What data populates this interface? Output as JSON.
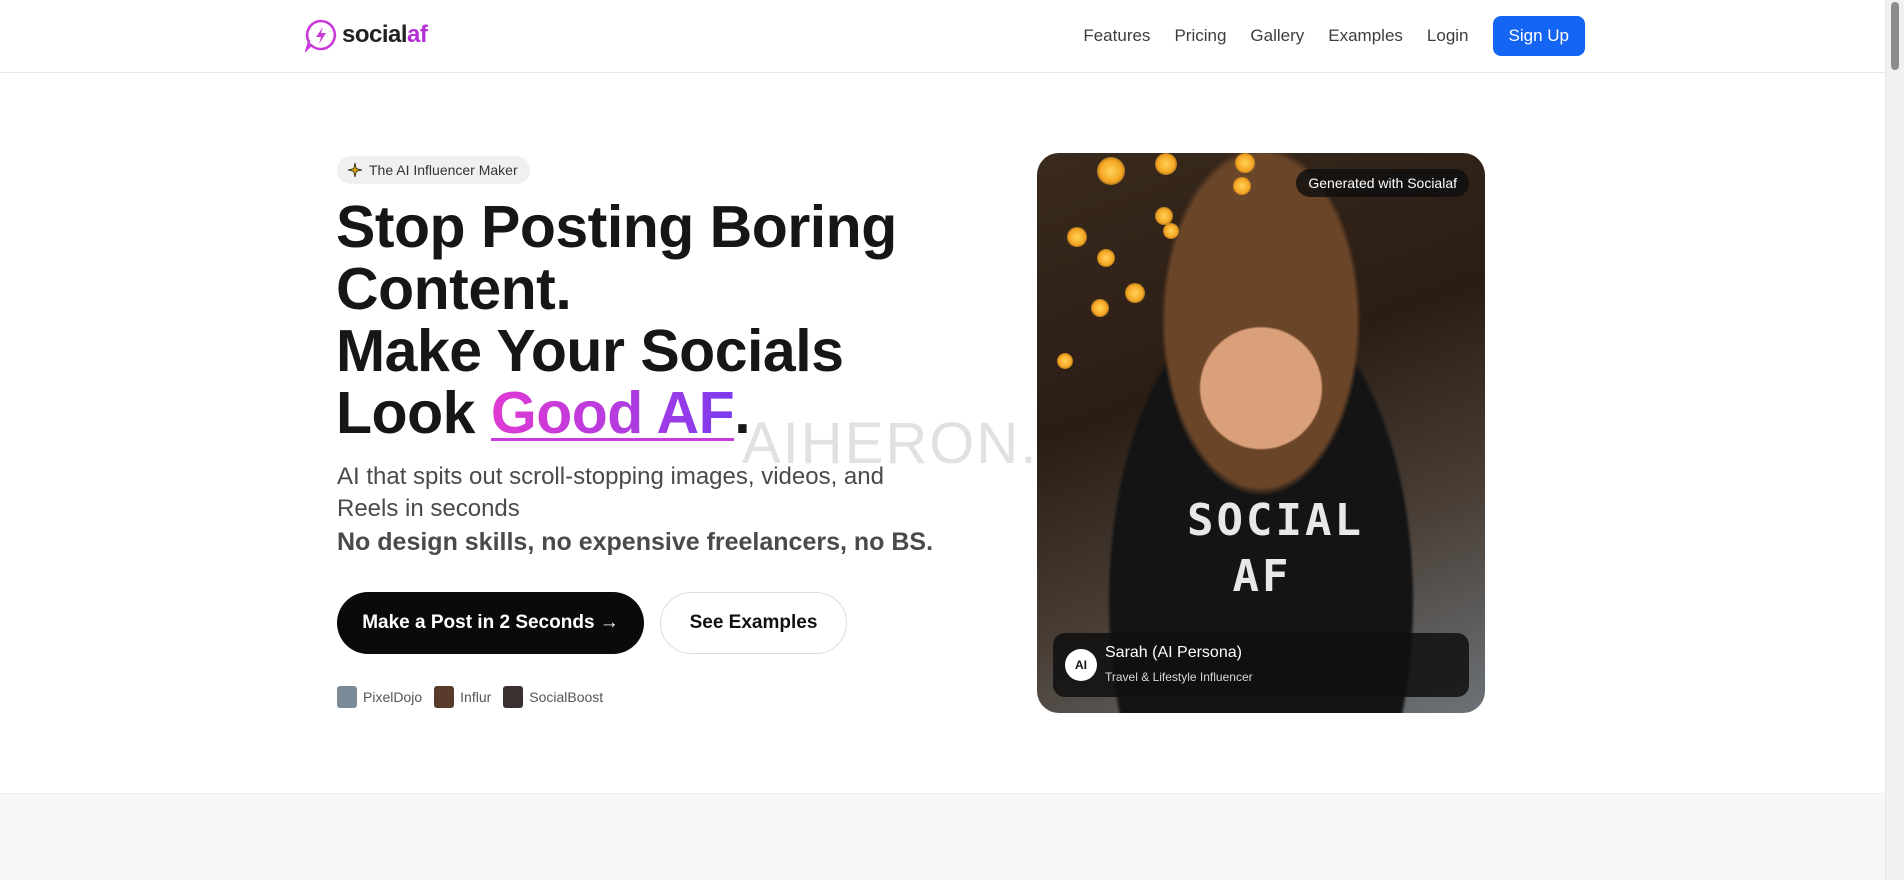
{
  "header": {
    "logo": {
      "name_prefix": "social",
      "name_suffix": "af"
    },
    "nav": [
      "Features",
      "Pricing",
      "Gallery",
      "Examples",
      "Login"
    ],
    "signup_label": "Sign Up"
  },
  "hero": {
    "badge": {
      "icon": "sparkle-icon",
      "label": "The AI Influencer Maker"
    },
    "headline": {
      "line1": "Stop Posting Boring",
      "line2": "Content.",
      "line3": "Make Your Socials",
      "line4_prefix": "Look ",
      "line4_highlight": "Good AF",
      "line4_suffix": "."
    },
    "subtext": "AI that spits out scroll-stopping images, videos, and Reels in seconds",
    "subtext_bold": "No design skills, no expensive freelancers, no BS.",
    "cta_primary": "Make a Post in 2 Seconds →",
    "cta_secondary": "See Examples",
    "partners": [
      {
        "name": "PixelDojo",
        "color": "#7a8a96"
      },
      {
        "name": "Influr",
        "color": "#5a3a2a"
      },
      {
        "name": "SocialBoost",
        "color": "#3a3030"
      }
    ]
  },
  "card": {
    "tag": "Generated with Socialaf",
    "shirt_line1": "SOCIAL",
    "shirt_line2": "AF",
    "persona": {
      "avatar": "AI",
      "name": "Sarah (AI Persona)",
      "role": "Travel & Lifestyle Influencer"
    }
  },
  "watermark": "AIHERON.C",
  "colors": {
    "brand_pink": "#b62fd8",
    "primary_blue": "#1565f5",
    "gradient_start": "#e03ad2",
    "gradient_end": "#7a3bf0"
  }
}
